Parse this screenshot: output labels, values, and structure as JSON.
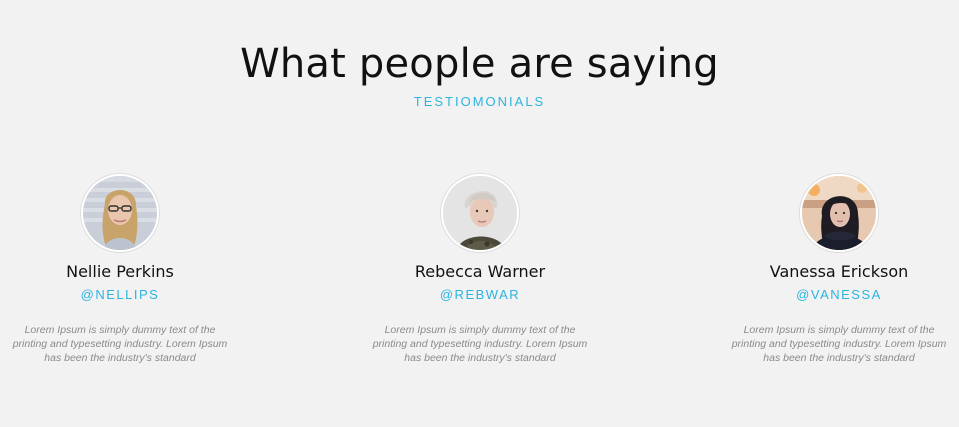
{
  "section": {
    "title": "What people are saying",
    "subtitle": "TESTIOMONIALS"
  },
  "testimonials": [
    {
      "name": "Nellie Perkins",
      "handle": "@NELLIPS",
      "quote": "Lorem Ipsum is simply dummy text of the printing and typesetting industry. Lorem Ipsum has been the industry's standard"
    },
    {
      "name": "Rebecca Warner",
      "handle": "@REBWAR",
      "quote": "Lorem Ipsum is simply dummy text of the printing and typesetting industry. Lorem Ipsum has been the industry's standard"
    },
    {
      "name": "Vanessa Erickson",
      "handle": "@VANESSA",
      "quote": "Lorem Ipsum is simply dummy text of the printing and typesetting industry. Lorem Ipsum has been the industry's standard"
    }
  ],
  "colors": {
    "background": "#f2f2f2",
    "accent": "#2bb4e0",
    "heading": "#111111",
    "body_text": "#8a8a8a"
  },
  "icons": [
    "avatar-photo-icon"
  ]
}
